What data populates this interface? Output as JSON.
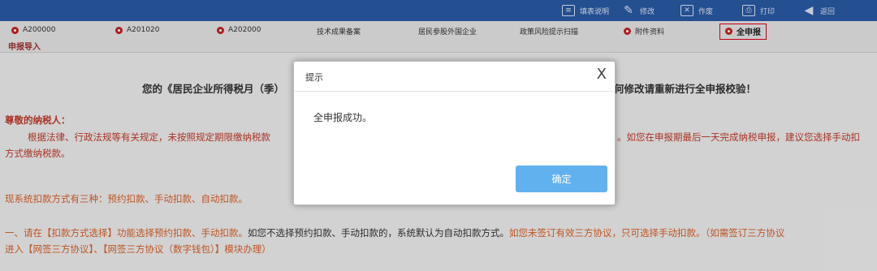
{
  "toolbar": {
    "fill_guide": "填表说明",
    "modify": "修改",
    "void": "作废",
    "print": "打印",
    "back": "返回"
  },
  "nav": {
    "items": [
      "A200000",
      "A201020",
      "A202000",
      "技术成果备案",
      "居民参股外国企业",
      "政策风险提示扫描",
      "附件资料",
      "全申报"
    ],
    "import": "申报导入"
  },
  "content": {
    "heading_left": "您的《居民企业所得税月（季）",
    "heading_right": "何修改请重新进行全申报校验！",
    "salutation": "尊敬的纳税人：",
    "para1_left": "根据法律、行政法规等有关规定，未按照规定期限缴纳税款",
    "para1_right": "。如您在申报期最后一天完成纳税申报，建议您选择手动扣",
    "para1_line2": "方式缴纳税款。",
    "methods": "现系统扣款方式有三种：预约扣款、手动扣款、自动扣款。",
    "step1_a": "一、请在【扣款方式选择】功能选择预约扣款、手动扣款。",
    "step1_b": "如您不选择预约扣款、手动扣款的，系统默认为自动扣款方式。",
    "step1_c": "如您未签订有效三方协议，只可选择手动扣款。（如需签订三方协议",
    "step1_line2": "进入【网签三方协议】、【网签三方协议（数字钱包）】模块办理）"
  },
  "dialog": {
    "title": "提示",
    "close": "X",
    "message": "全申报成功。",
    "confirm": "确定"
  }
}
